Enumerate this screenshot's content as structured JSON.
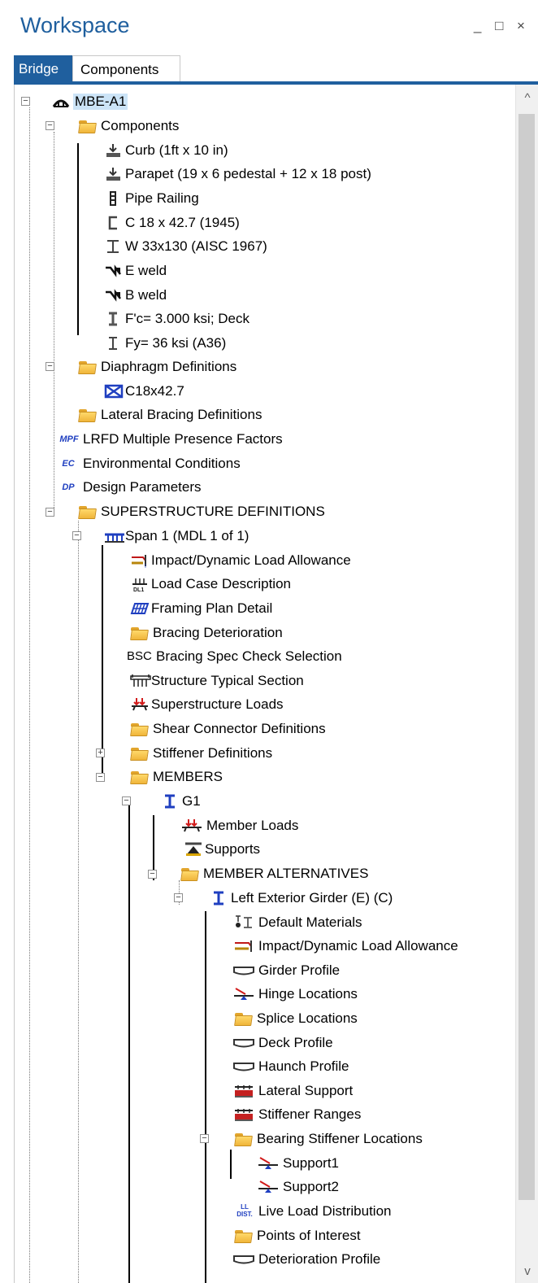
{
  "window": {
    "title": "Workspace",
    "buttons": "_ □ ×"
  },
  "tabs": [
    {
      "label": "Bridge",
      "active": true
    },
    {
      "label": "Components",
      "active": false
    }
  ],
  "scroll": {
    "up": "^",
    "down": "v"
  },
  "tree": {
    "root": "MBE-A1",
    "components": "Components",
    "curb": "Curb (1ft x 10 in)",
    "parapet": "Parapet (19 x 6 pedestal + 12 x 18 post)",
    "pipe_railing": "Pipe Railing",
    "c18": "C 18 x 42.7 (1945)",
    "w33": "W 33x130 (AISC 1967)",
    "e_weld": "E weld",
    "b_weld": "B weld",
    "fc": "F'c= 3.000 ksi; Deck",
    "fy": "Fy= 36 ksi (A36)",
    "diaphragm_defs": "Diaphragm Definitions",
    "c18x42": "C18x42.7",
    "lateral_bracing_defs": "Lateral Bracing Definitions",
    "mpf": "LRFD Multiple Presence Factors",
    "env": "Environmental Conditions",
    "design_params": "Design Parameters",
    "superstructure_defs": "SUPERSTRUCTURE DEFINITIONS",
    "span1": "Span 1 (MDL 1 of 1)",
    "impact1": "Impact/Dynamic Load Allowance",
    "load_case": "Load Case Description",
    "framing_plan": "Framing Plan Detail",
    "bracing_det": "Bracing Deterioration",
    "bracing_spec": "Bracing Spec Check Selection",
    "typical_section": "Structure Typical Section",
    "super_loads": "Superstructure Loads",
    "shear_conn": "Shear Connector Definitions",
    "stiff_defs": "Stiffener Definitions",
    "members": "MEMBERS",
    "g1": "G1",
    "member_loads": "Member Loads",
    "supports": "Supports",
    "member_alts": "MEMBER ALTERNATIVES",
    "left_ext": "Left Exterior Girder (E)  (C)",
    "default_materials": "Default Materials",
    "impact2": "Impact/Dynamic Load Allowance",
    "girder_profile": "Girder Profile",
    "hinge_locations": "Hinge Locations",
    "splice_locations": "Splice Locations",
    "deck_profile": "Deck Profile",
    "haunch_profile": "Haunch Profile",
    "lateral_support": "Lateral Support",
    "stiffener_ranges": "Stiffener Ranges",
    "bearing_stiff": "Bearing Stiffener Locations",
    "support1": "Support1",
    "support2": "Support2",
    "lld": "Live Load Distribution",
    "poi": "Points of Interest",
    "det_profile": "Deterioration Profile"
  },
  "icon_text": {
    "mpf": "MPF",
    "ec": "EC",
    "dp": "DP",
    "bsc": "BSC",
    "ll": "LL DIST."
  },
  "colors": {
    "accent": "#1f5f9e",
    "folder": "#f0b53a",
    "member_blue": "#1f3fc0",
    "load_red": "#d11b1b"
  }
}
